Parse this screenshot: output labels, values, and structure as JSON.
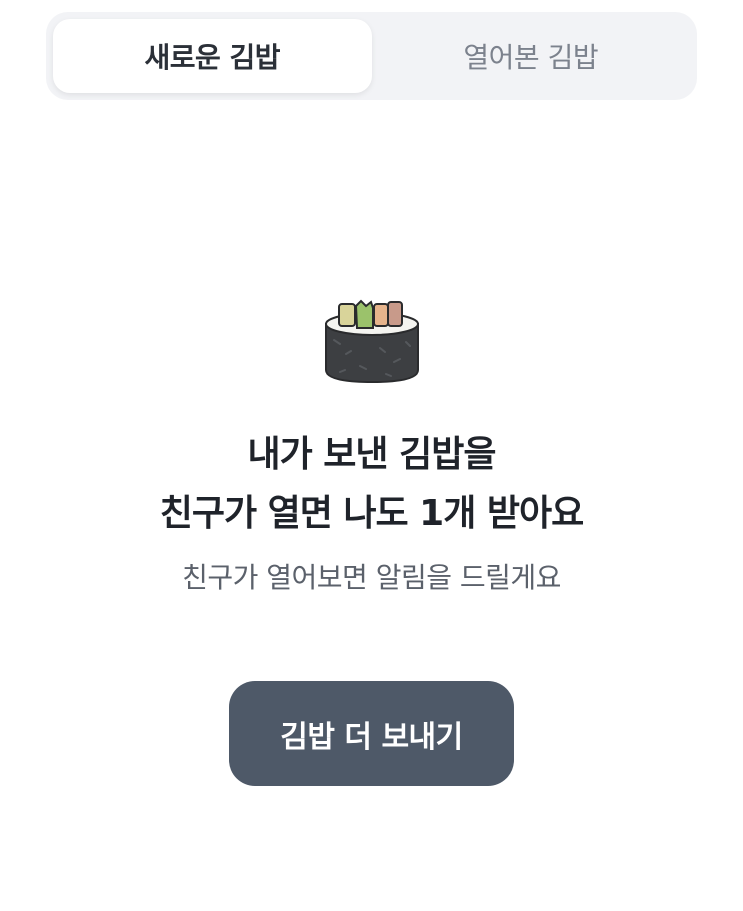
{
  "tabs": {
    "new_label": "새로운 김밥",
    "opened_label": "열어본 김밥",
    "active": "new"
  },
  "illustration": {
    "icon": "kimbap-icon"
  },
  "message": {
    "line1": "내가 보낸 김밥을",
    "line2": "친구가 열면 나도 1개 받아요",
    "sub": "친구가 열어보면 알림을 드릴게요"
  },
  "actions": {
    "send_more_label": "김밥 더 보내기"
  },
  "colors": {
    "button_bg": "#4e5968",
    "segment_bg": "#f2f3f6",
    "headline": "#1f232a",
    "subtext": "#5b616b"
  }
}
